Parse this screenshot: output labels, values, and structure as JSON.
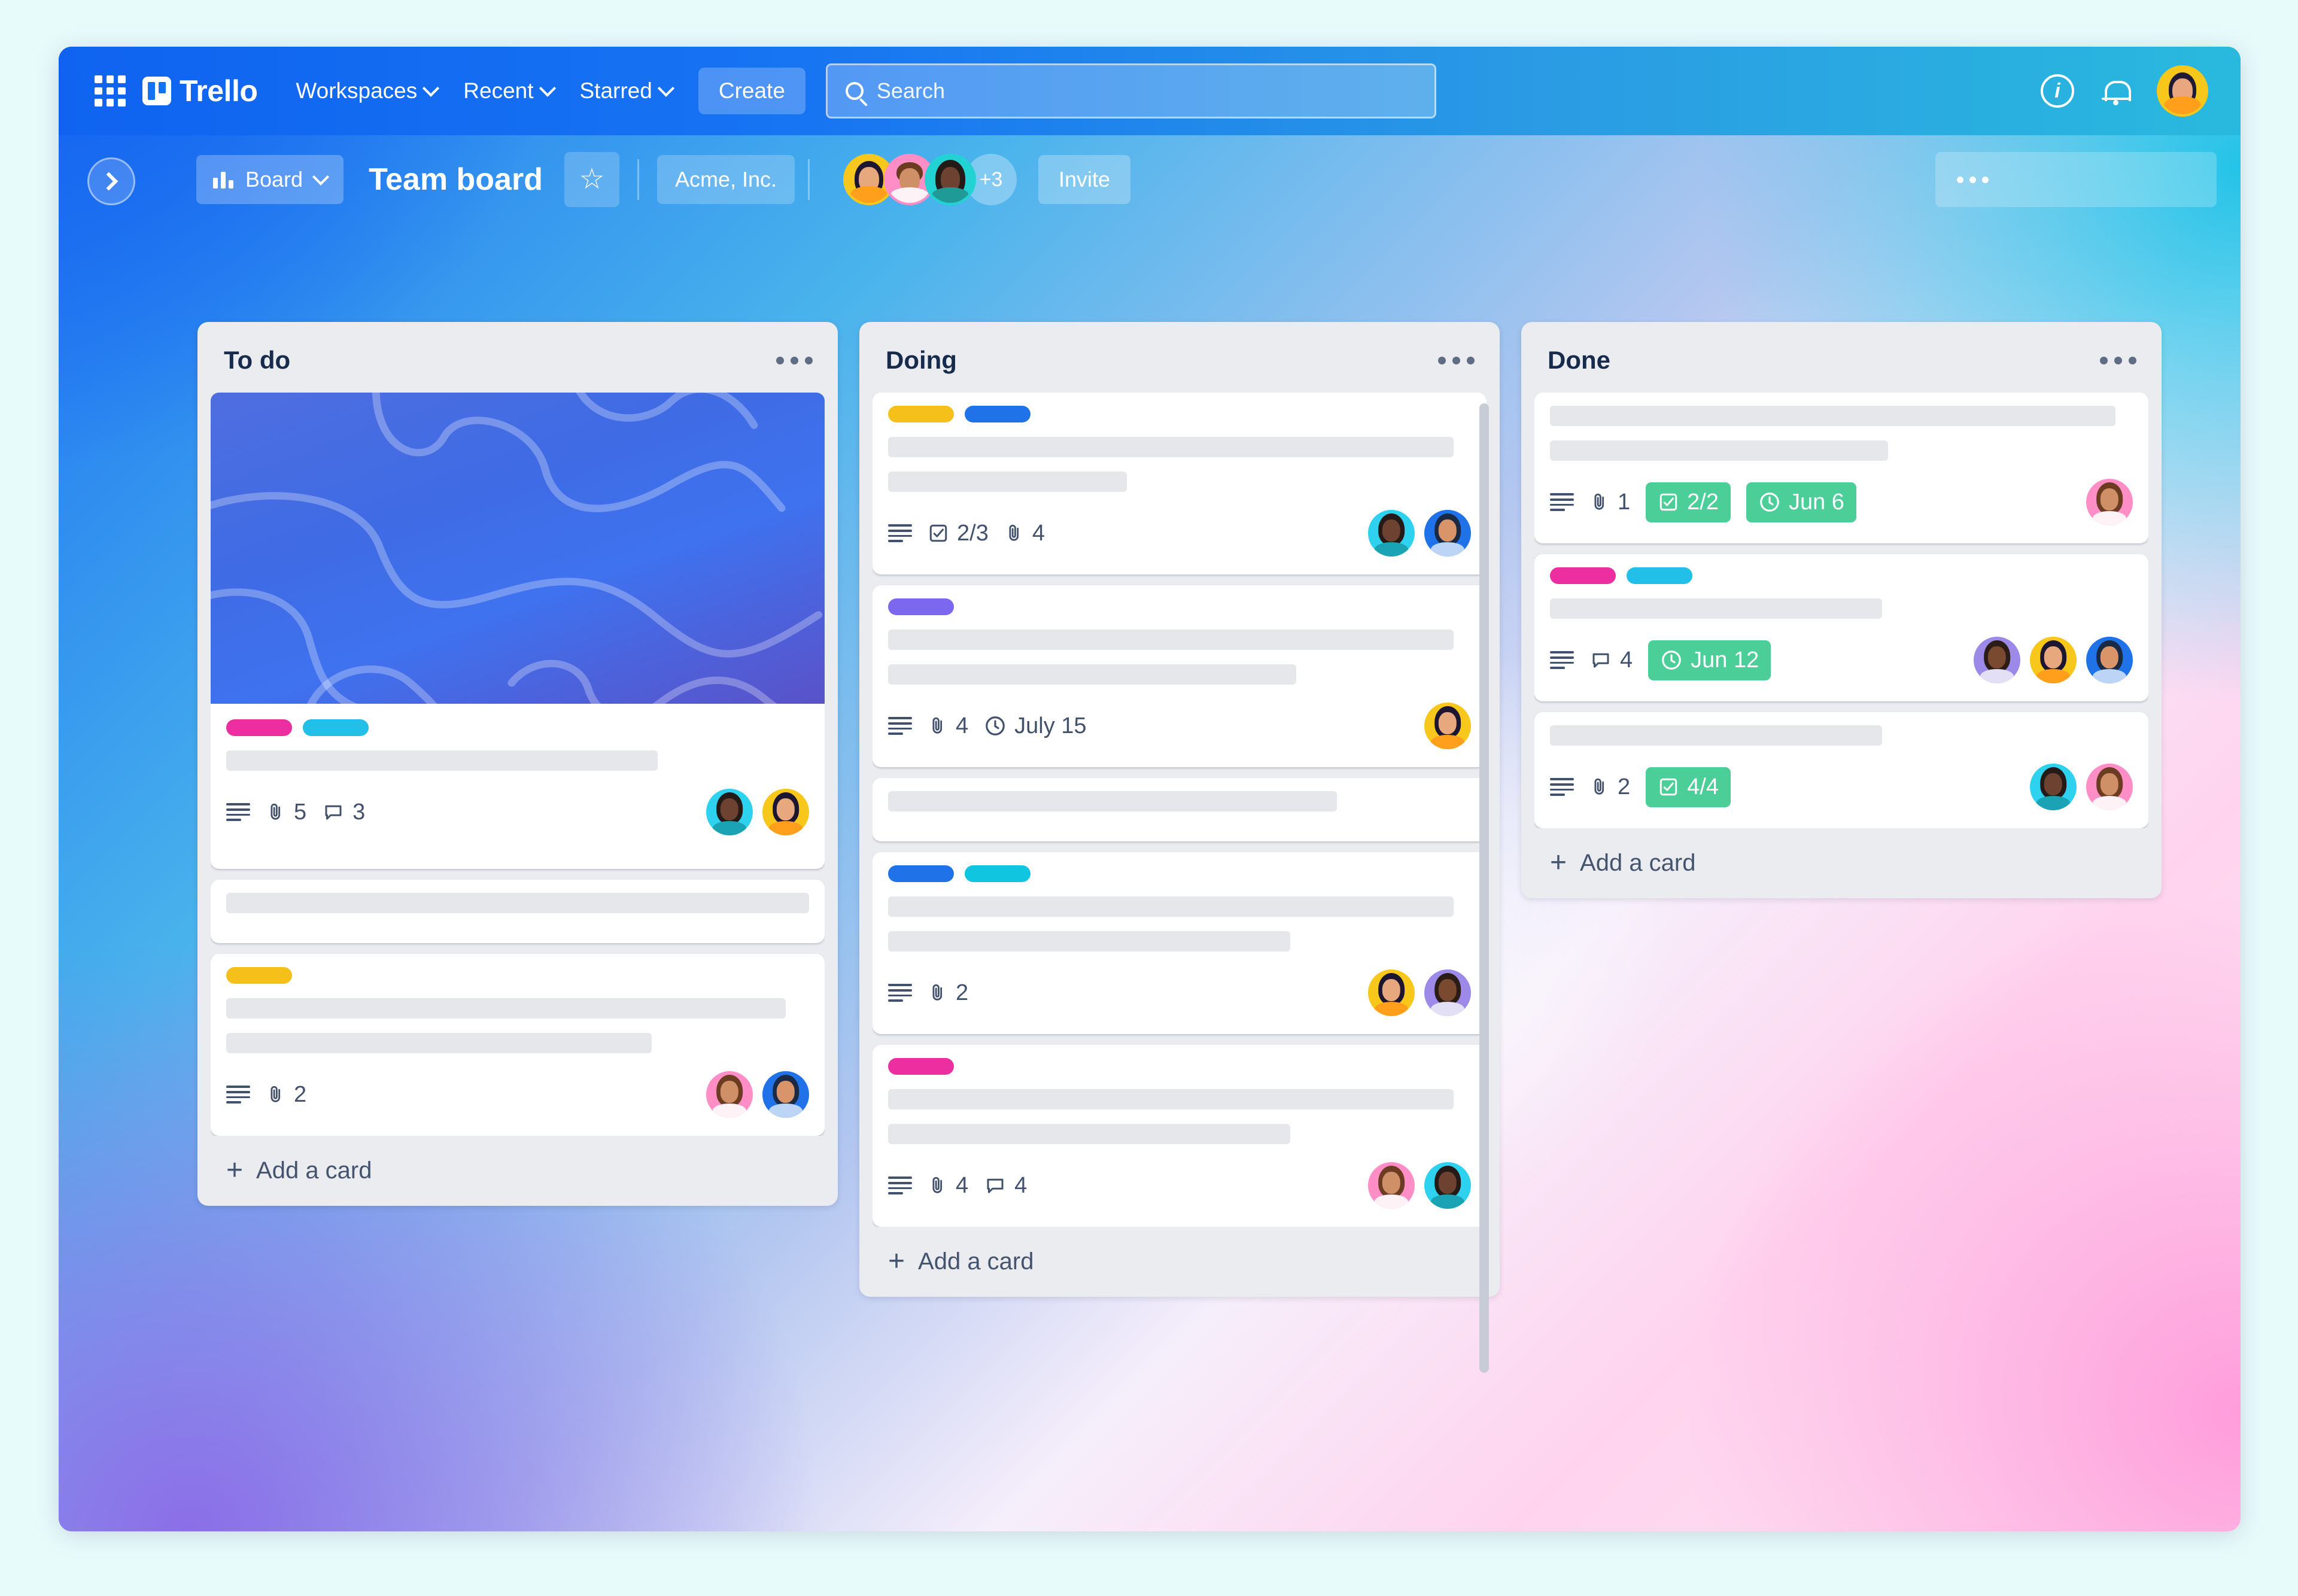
{
  "topnav": {
    "apps_icon": "grid-apps-icon",
    "brand": "Trello",
    "links": [
      {
        "label": "Workspaces"
      },
      {
        "label": "Recent"
      },
      {
        "label": "Starred"
      }
    ],
    "create_label": "Create",
    "search_placeholder": "Search",
    "search_value": "",
    "info_label": "i",
    "icons": [
      "info-icon",
      "notifications-bell-icon",
      "account-avatar"
    ]
  },
  "boardbar": {
    "view_label": "Board",
    "board_title": "Team board",
    "workspace": "Acme, Inc.",
    "extra_members": "+3",
    "invite_label": "Invite",
    "star_glyph": "☆"
  },
  "lists": [
    {
      "title": "To do",
      "add_card_label": "Add a card",
      "cards": [
        {
          "cover": true,
          "labels": [
            "#ec2ea0",
            "#22c0e8"
          ],
          "skeletons": [
            {
              "w": "74%"
            }
          ],
          "badges": [
            {
              "type": "description",
              "text": ""
            },
            {
              "type": "attachment",
              "text": "5"
            },
            {
              "type": "comment",
              "text": "3"
            }
          ],
          "avatars": [
            "cyan",
            "yellow"
          ]
        },
        {
          "cover": false,
          "labels": [],
          "skeletons": [
            {
              "w": "100%"
            }
          ],
          "badges": [],
          "avatars": []
        },
        {
          "cover": false,
          "labels": [
            "#f5c01a"
          ],
          "skeletons": [
            {
              "w": "96%"
            },
            {
              "w": "73%"
            }
          ],
          "badges": [
            {
              "type": "description",
              "text": ""
            },
            {
              "type": "attachment",
              "text": "2"
            }
          ],
          "avatars": [
            "pink",
            "blue"
          ]
        }
      ]
    },
    {
      "title": "Doing",
      "add_card_label": "Add a card",
      "cards": [
        {
          "cover": false,
          "labels": [
            "#f5c01a",
            "#1f72e8"
          ],
          "skeletons": [
            {
              "w": "97%"
            },
            {
              "w": "41%"
            }
          ],
          "badges": [
            {
              "type": "description",
              "text": ""
            },
            {
              "type": "checklist",
              "text": "2/3"
            },
            {
              "type": "attachment",
              "text": "4"
            }
          ],
          "avatars": [
            "cyan",
            "blue"
          ]
        },
        {
          "cover": false,
          "labels": [
            "#7b68ee"
          ],
          "skeletons": [
            {
              "w": "97%"
            },
            {
              "w": "70%"
            }
          ],
          "badges": [
            {
              "type": "description",
              "text": ""
            },
            {
              "type": "attachment",
              "text": "4"
            },
            {
              "type": "due",
              "text": "July 15"
            }
          ],
          "avatars": [
            "yellow"
          ]
        },
        {
          "cover": false,
          "labels": [],
          "skeletons": [
            {
              "w": "77%"
            }
          ],
          "badges": [],
          "avatars": []
        },
        {
          "cover": false,
          "labels": [
            "#1f72e8",
            "#10c5e0"
          ],
          "skeletons": [
            {
              "w": "97%"
            },
            {
              "w": "69%"
            }
          ],
          "badges": [
            {
              "type": "description",
              "text": ""
            },
            {
              "type": "attachment",
              "text": "2"
            }
          ],
          "avatars": [
            "yellow",
            "purple"
          ]
        },
        {
          "cover": false,
          "labels": [
            "#ec2ea0"
          ],
          "skeletons": [
            {
              "w": "97%"
            },
            {
              "w": "69%"
            }
          ],
          "badges": [
            {
              "type": "description",
              "text": ""
            },
            {
              "type": "attachment",
              "text": "4"
            },
            {
              "type": "comment",
              "text": "4"
            }
          ],
          "avatars": [
            "pink",
            "cyan"
          ]
        }
      ]
    },
    {
      "title": "Done",
      "add_card_label": "Add a card",
      "cards": [
        {
          "cover": false,
          "labels": [],
          "skeletons": [
            {
              "w": "97%"
            },
            {
              "w": "58%"
            }
          ],
          "badges": [
            {
              "type": "description",
              "text": ""
            },
            {
              "type": "attachment",
              "text": "1"
            },
            {
              "type": "checklist-done",
              "text": "2/2"
            },
            {
              "type": "due-done",
              "text": "Jun 6"
            }
          ],
          "avatars": [
            "pink"
          ]
        },
        {
          "cover": false,
          "labels": [
            "#ec2ea0",
            "#22c0e8"
          ],
          "skeletons": [
            {
              "w": "57%"
            }
          ],
          "badges": [
            {
              "type": "description",
              "text": ""
            },
            {
              "type": "comment",
              "text": "4"
            },
            {
              "type": "due-done",
              "text": "Jun 12"
            }
          ],
          "avatars": [
            "purple",
            "yellow",
            "blue"
          ]
        },
        {
          "cover": false,
          "labels": [],
          "skeletons": [
            {
              "w": "57%"
            }
          ],
          "badges": [
            {
              "type": "description",
              "text": ""
            },
            {
              "type": "attachment",
              "text": "2"
            },
            {
              "type": "checklist-done",
              "text": "4/4"
            }
          ],
          "avatars": [
            "cyan",
            "pink"
          ]
        }
      ]
    }
  ],
  "colors": {
    "green_badge": "#4bce97",
    "list_bg": "#ebecf0",
    "text_dark": "#172b4d",
    "nav_blue": "#0f63f0",
    "nav_cyan": "#29b9de"
  }
}
